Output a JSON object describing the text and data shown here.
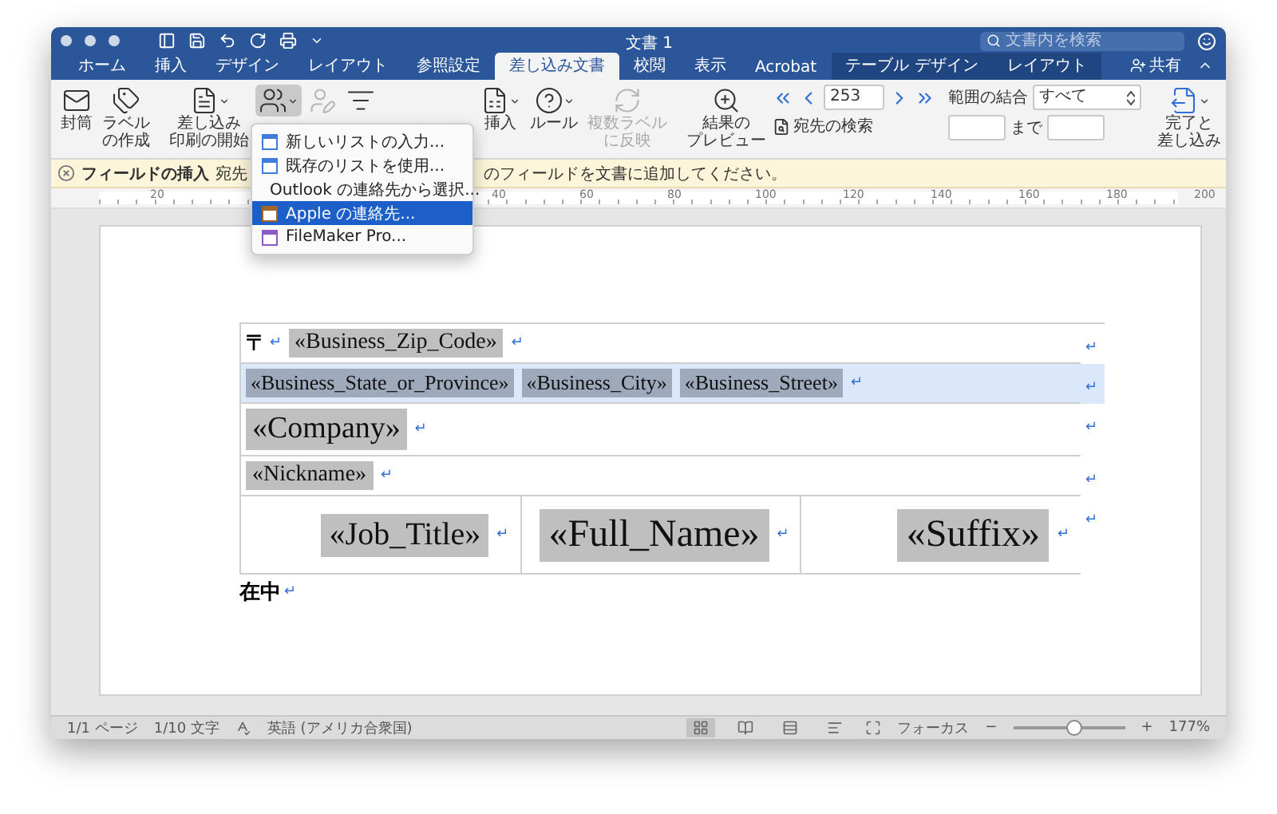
{
  "window": {
    "title": "文書 1",
    "search_placeholder": "文書内を検索",
    "share": "共有"
  },
  "tabs": [
    {
      "label": "ホーム",
      "selected": false,
      "contextual": false
    },
    {
      "label": "挿入",
      "selected": false,
      "contextual": false
    },
    {
      "label": "デザイン",
      "selected": false,
      "contextual": false
    },
    {
      "label": "レイアウト",
      "selected": false,
      "contextual": false
    },
    {
      "label": "参照設定",
      "selected": false,
      "contextual": false
    },
    {
      "label": "差し込み文書",
      "selected": true,
      "contextual": false
    },
    {
      "label": "校閲",
      "selected": false,
      "contextual": false
    },
    {
      "label": "表示",
      "selected": false,
      "contextual": false
    },
    {
      "label": "Acrobat",
      "selected": false,
      "contextual": false
    },
    {
      "label": "テーブル デザイン",
      "selected": false,
      "contextual": true
    },
    {
      "label": "レイアウト",
      "selected": false,
      "contextual": true
    }
  ],
  "ribbon": {
    "buttons": [
      {
        "label": [
          "封筒"
        ],
        "disabled": false,
        "pressed": false,
        "caret": false
      },
      {
        "label": [
          "ラベル",
          "の作成"
        ],
        "disabled": false,
        "pressed": false,
        "caret": false
      },
      {
        "label": [
          "差し込み",
          "印刷の開始"
        ],
        "disabled": false,
        "pressed": false,
        "caret": true
      },
      {
        "disabled": false,
        "pressed": true,
        "caret": true
      },
      {
        "disabled": true,
        "pressed": false,
        "caret": false
      },
      {
        "disabled": false,
        "pressed": false,
        "caret": false
      },
      {
        "label": [
          "挿入"
        ],
        "disabled": false,
        "pressed": false,
        "caret": true
      },
      {
        "label": [
          "ルール"
        ],
        "disabled": false,
        "pressed": false,
        "caret": true
      },
      {
        "label": [
          "複数ラベル",
          "に反映"
        ],
        "disabled": true,
        "pressed": false,
        "caret": false
      },
      {
        "label": [
          "結果の",
          "プレビュー"
        ],
        "disabled": false,
        "pressed": false,
        "caret": false
      }
    ],
    "record": "253",
    "find_recipient": "宛先の検索",
    "merge_range_label": "範囲の結合",
    "merge_range_value": "すべて",
    "to_label": "まで",
    "finish": [
      "完了と",
      "差し込み"
    ]
  },
  "menu": {
    "items": [
      {
        "label": "新しいリストの入力...",
        "selected": false
      },
      {
        "label": "既存のリストを使用...",
        "selected": false
      },
      {
        "label": "Outlook の連絡先から選択...",
        "selected": false
      },
      {
        "label": "Apple の連絡先...",
        "selected": true
      },
      {
        "label": "FileMaker Pro...",
        "selected": false
      }
    ]
  },
  "message_bar": {
    "title": "フィールドの挿入",
    "text_start": "宛先",
    "text_end": "のフィールドを文書に追加してください。"
  },
  "ruler": {
    "labels": [
      "20",
      "40",
      "60",
      "80",
      "100",
      "120",
      "140",
      "160",
      "180",
      "200"
    ]
  },
  "document": {
    "rows": [
      {
        "selected": false,
        "row_mark": "↵",
        "cells": [
          {
            "items": [
              {
                "kind": "text",
                "text": "〒"
              },
              {
                "kind": "mark",
                "text": "↵"
              },
              {
                "kind": "field",
                "text": "«Business_Zip_Code»"
              },
              {
                "kind": "mark",
                "text": "↵"
              }
            ]
          }
        ]
      },
      {
        "selected": true,
        "row_mark": "↵",
        "cells": [
          {
            "items": [
              {
                "kind": "smallfield",
                "text": "«Business_State_or_Province»"
              },
              {
                "kind": "smallfield",
                "text": "«Business_City»"
              },
              {
                "kind": "smallfield",
                "text": "«Business_Street»"
              },
              {
                "kind": "mark",
                "text": "↵"
              }
            ]
          }
        ]
      },
      {
        "selected": false,
        "row_mark": "↵",
        "cells": [
          {
            "items": [
              {
                "kind": "bigfield",
                "text": "«Company»"
              },
              {
                "kind": "mark",
                "text": "↵"
              }
            ]
          }
        ]
      },
      {
        "selected": false,
        "row_mark": "↵",
        "cells": [
          {
            "items": [
              {
                "kind": "field",
                "text": "«Nickname»"
              },
              {
                "kind": "mark",
                "text": "↵"
              }
            ]
          }
        ]
      },
      {
        "selected": false,
        "row_mark": "↵",
        "cells": [
          {
            "items": [
              {
                "kind": "hugefield",
                "text": "«Job_Title»"
              },
              {
                "kind": "mark",
                "text": "↵"
              }
            ]
          },
          {
            "items": [
              {
                "kind": "giantfield",
                "text": "«Full_Name»"
              },
              {
                "kind": "mark",
                "text": "↵"
              }
            ]
          },
          {
            "items": [
              {
                "kind": "giantfield",
                "text": "«Suffix»"
              },
              {
                "kind": "mark",
                "text": "↵"
              }
            ]
          }
        ]
      }
    ],
    "after": [
      {
        "kind": "text",
        "text": "在中"
      },
      {
        "kind": "mark",
        "text": "↵"
      }
    ]
  },
  "status_bar": {
    "page": "1/1 ページ",
    "words": "1/10 文字",
    "language": "英語 (アメリカ合衆国)",
    "focus": "フォーカス",
    "zoom_out": "−",
    "zoom_in": "+",
    "zoom": "177%",
    "zoom_slider": {
      "level": 0.55
    }
  }
}
